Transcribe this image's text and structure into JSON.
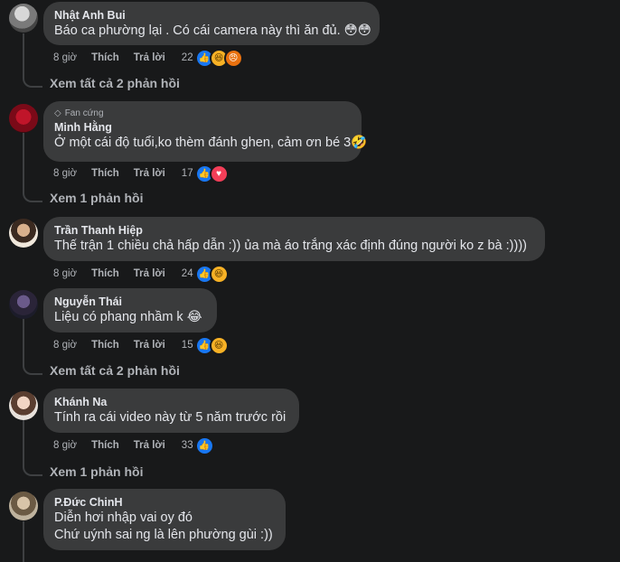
{
  "labels": {
    "like": "Thích",
    "reply": "Trả lời"
  },
  "comments": [
    {
      "author": "Nhật Anh Bui",
      "lines": [
        "Báo ca phường lại . Có cái camera này thì ăn đủ. 😳😳"
      ],
      "time": "8 giờ",
      "reaction_count": "22",
      "reactions": [
        "like",
        "haha",
        "angry"
      ],
      "view_replies": "Xem tất cả 2 phản hồi"
    },
    {
      "badge": "Fan cứng",
      "author": "Minh Hằng",
      "lines": [
        "Ở một cái độ tuổi,ko thèm đánh ghen, cảm ơn bé 3🤣"
      ],
      "time": "8 giờ",
      "reaction_count": "17",
      "reactions": [
        "like",
        "love"
      ],
      "view_replies": "Xem 1 phản hồi"
    },
    {
      "author": "Trần Thanh Hiệp",
      "lines": [
        "Thế trận 1 chiều chả hấp dẫn :)) ủa mà áo trắng xác định đúng người ko z bà :))))"
      ],
      "time": "8 giờ",
      "reaction_count": "24",
      "reactions": [
        "like",
        "haha"
      ]
    },
    {
      "author": "Nguyễn Thái",
      "lines": [
        "Liệu có phang nhầm k 😂"
      ],
      "time": "8 giờ",
      "reaction_count": "15",
      "reactions": [
        "like",
        "haha"
      ],
      "view_replies": "Xem tất cả 2 phản hồi"
    },
    {
      "author": "Khánh Na",
      "lines": [
        "Tính ra cái video này từ 5 năm trước rồi"
      ],
      "time": "8 giờ",
      "reaction_count": "33",
      "reactions": [
        "like"
      ],
      "view_replies": "Xem 1 phản hồi"
    },
    {
      "author": "P.Đức ChinH",
      "lines": [
        "Diễn hơi nhập vai oy đó",
        "Chứ uýnh sai ng là lên phường gùi :))"
      ]
    }
  ],
  "colors": {
    "like": "#1877f2",
    "haha": "#f7b125",
    "love": "#f33e58",
    "angry": "#e9710f"
  }
}
